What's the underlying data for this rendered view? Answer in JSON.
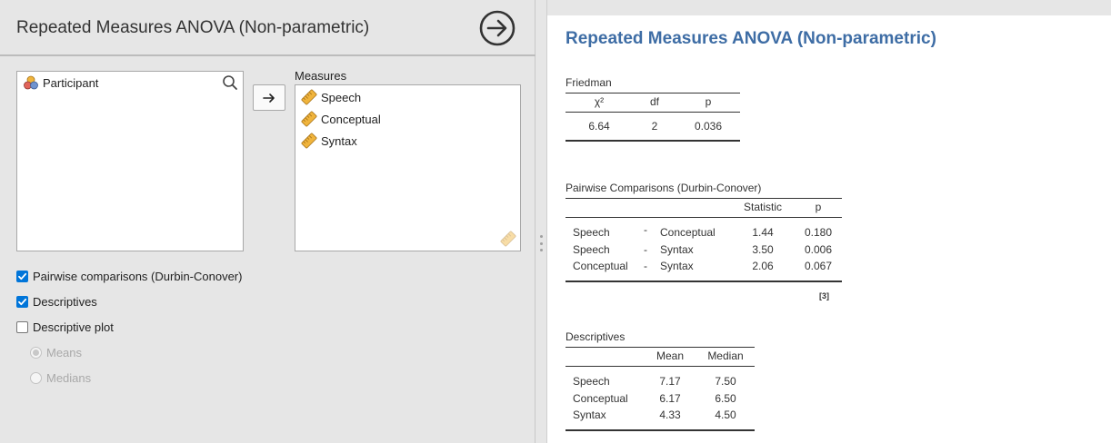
{
  "options": {
    "title": "Repeated Measures ANOVA (Non-parametric)",
    "source_variables": [
      {
        "label": "Participant",
        "icon": "nominal-variable-icon"
      }
    ],
    "measures_label": "Measures",
    "measures": [
      {
        "label": "Speech",
        "icon": "ruler-icon"
      },
      {
        "label": "Conceptual",
        "icon": "ruler-icon"
      },
      {
        "label": "Syntax",
        "icon": "ruler-icon"
      }
    ],
    "checkboxes": [
      {
        "label": "Pairwise comparisons (Durbin-Conover)",
        "checked": true
      },
      {
        "label": "Descriptives",
        "checked": true
      },
      {
        "label": "Descriptive plot",
        "checked": false
      }
    ],
    "plot_options": [
      {
        "label": "Means",
        "selected": true,
        "enabled": false
      },
      {
        "label": "Medians",
        "selected": false,
        "enabled": false
      }
    ]
  },
  "results": {
    "heading": "Repeated Measures ANOVA (Non-parametric)",
    "friedman": {
      "caption": "Friedman",
      "headers": [
        "χ²",
        "df",
        "p"
      ],
      "rows": [
        [
          "6.64",
          "2",
          "0.036"
        ]
      ]
    },
    "pairwise": {
      "caption": "Pairwise Comparisons (Durbin-Conover)",
      "headers": [
        "",
        "",
        "",
        "Statistic",
        "p"
      ],
      "rows": [
        [
          "Speech",
          "-",
          "Conceptual",
          "1.44",
          "0.180"
        ],
        [
          "Speech",
          "-",
          "Syntax",
          "3.50",
          "0.006"
        ],
        [
          "Conceptual",
          "-",
          "Syntax",
          "2.06",
          "0.067"
        ]
      ],
      "footnote": "[3]"
    },
    "descriptives": {
      "caption": "Descriptives",
      "headers": [
        "",
        "Mean",
        "Median"
      ],
      "rows": [
        [
          "Speech",
          "7.17",
          "7.50"
        ],
        [
          "Conceptual",
          "6.17",
          "6.50"
        ],
        [
          "Syntax",
          "4.33",
          "4.50"
        ]
      ]
    }
  },
  "colors": {
    "accent": "#3e6da5",
    "checkbox": "#0075d9",
    "ruler": "#f0b43c"
  }
}
